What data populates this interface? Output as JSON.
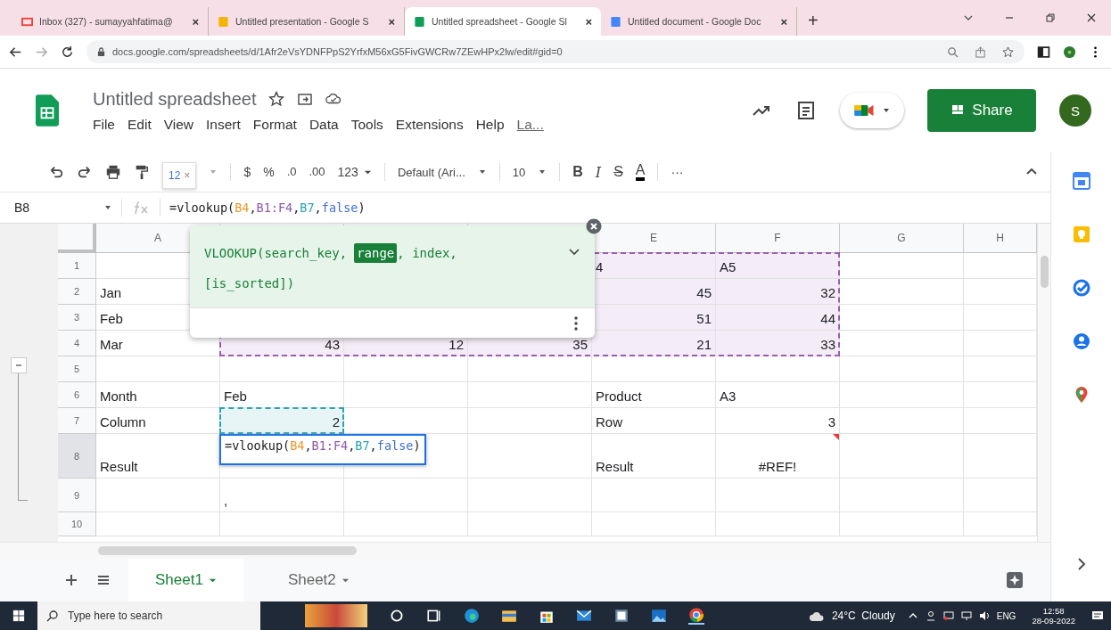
{
  "browser": {
    "tabs": [
      {
        "kind": "gmail",
        "title": "Inbox (327) - sumayyahfatima@",
        "close": "×",
        "selected": false
      },
      {
        "kind": "slides",
        "title": "Untitled presentation - Google S",
        "close": "×",
        "selected": false
      },
      {
        "kind": "sheets",
        "title": "Untitled spreadsheet - Google Sl",
        "close": "×",
        "selected": true
      },
      {
        "kind": "docs",
        "title": "Untitled document - Google Doc",
        "close": "×",
        "selected": false
      }
    ],
    "new_tab": "+",
    "url": "docs.google.com/spreadsheets/d/1Afr2eVsYDNFPpS2YrfxM56xG5FivGWCRw7ZEwHPx2lw/edit#gid=0"
  },
  "app": {
    "title": "Untitled spreadsheet",
    "menu": [
      "File",
      "Edit",
      "View",
      "Insert",
      "Format",
      "Data",
      "Tools",
      "Extensions",
      "Help"
    ],
    "last_edit": "La...",
    "share": "Share",
    "avatar": "S"
  },
  "toolbar": {
    "zoom": "12",
    "zoom_close": "×",
    "currency": "$",
    "percent": "%",
    "decrease_decimals": ".0",
    "increase_decimals": ".00",
    "more_formats": "123",
    "font": "Default (Ari...",
    "font_size": "10",
    "bold": "B",
    "italic": "I",
    "strikethrough": "S",
    "text_color": "A",
    "more": "···"
  },
  "formula_bar": {
    "name_box": "B8",
    "tokens": [
      {
        "text": "=vlookup("
      },
      {
        "text": "B4",
        "color": "#e69b2e"
      },
      {
        "text": ","
      },
      {
        "text": "B1:F4",
        "color": "#8e5ba8"
      },
      {
        "text": ","
      },
      {
        "text": "B7",
        "color": "#2aa4b0"
      },
      {
        "text": ","
      },
      {
        "text": "false",
        "color": "#3d6fd1"
      },
      {
        "text": ")"
      }
    ]
  },
  "grid": {
    "columns": [
      {
        "label": "A",
        "selected": false
      },
      {},
      {},
      {},
      {
        "label": "E",
        "selected": false
      },
      {
        "label": "F",
        "selected": false
      },
      {
        "label": "G",
        "selected": false
      },
      {
        "label": "H",
        "selected": false
      }
    ],
    "rows": [
      {
        "label": "1",
        "selected": false,
        "cells": [
          {},
          {},
          {},
          {},
          {
            "text": "4",
            "highlighted": true
          },
          {
            "text": "A5",
            "highlighted": true
          },
          {},
          {}
        ]
      },
      {
        "label": "2",
        "selected": false,
        "cells": [
          {
            "text": "Jan"
          },
          {},
          {},
          {},
          {
            "text": "45",
            "kind": "number",
            "highlighted": true
          },
          {
            "text": "32",
            "kind": "number",
            "highlighted": true
          },
          {},
          {}
        ]
      },
      {
        "label": "3",
        "selected": false,
        "cells": [
          {
            "text": "Feb"
          },
          {},
          {},
          {},
          {
            "text": "51",
            "kind": "number",
            "highlighted": true
          },
          {
            "text": "44",
            "kind": "number",
            "highlighted": true
          },
          {},
          {}
        ]
      },
      {
        "label": "4",
        "selected": false,
        "cells": [
          {
            "text": "Mar"
          },
          {
            "text": "43",
            "kind": "number",
            "highlighted": true
          },
          {
            "text": "12",
            "kind": "number",
            "highlighted": true
          },
          {
            "text": "35",
            "kind": "number",
            "highlighted": true
          },
          {
            "text": "21",
            "kind": "number",
            "highlighted": true
          },
          {
            "text": "33",
            "kind": "number",
            "highlighted": true,
            "color": "#9c5bb5"
          },
          {},
          {}
        ]
      },
      {
        "label": "5",
        "selected": false,
        "cells": [
          {},
          {},
          {},
          {},
          {},
          {},
          {},
          {}
        ]
      },
      {
        "label": "6",
        "selected": false,
        "cells": [
          {
            "text": "Month"
          },
          {
            "text": "Feb"
          },
          {},
          {},
          {
            "text": "Product"
          },
          {
            "text": "A3"
          },
          {},
          {}
        ]
      },
      {
        "label": "7",
        "selected": false,
        "cells": [
          {
            "text": "Column"
          },
          {
            "text": "2",
            "kind": "number",
            "highlighted": true,
            "color": "#2aa4b0"
          },
          {},
          {},
          {
            "text": "Row"
          },
          {
            "text": "3",
            "kind": "number"
          },
          {},
          {}
        ]
      },
      {
        "label": "8",
        "selected": true,
        "cells": [
          {
            "text": "Result"
          },
          {
            "editor": [
              {
                "text": "=vlookup("
              },
              {
                "text": "B4",
                "color": "#e69b2e"
              },
              {
                "text": ","
              },
              {
                "text": "B1:F4",
                "color": "#8e5ba8"
              },
              {
                "text": ","
              },
              {
                "text": "B7",
                "color": "#2aa4b0"
              },
              {
                "text": ","
              },
              {
                "text": "false",
                "color": "#3d6fd1"
              },
              {
                "text": ")"
              }
            ]
          },
          {},
          {},
          {
            "text": "Result"
          },
          {
            "text": "#REF!",
            "kind": "error"
          },
          {},
          {}
        ]
      },
      {
        "label": "9",
        "selected": false,
        "cells": [
          {},
          {
            "text": ","
          },
          {},
          {},
          {},
          {},
          {},
          {}
        ]
      },
      {
        "label": "10",
        "selected": false,
        "cells": [
          {},
          {},
          {},
          {},
          {},
          {},
          {},
          {}
        ]
      }
    ]
  },
  "formula_help": {
    "signature": [
      {
        "text": "VLOOKUP(search_key,",
        "selected": false
      },
      {
        "text": "range",
        "selected": true
      },
      {
        "text": ", index,",
        "selected": false
      },
      {
        "text": "[is_sorted])",
        "selected": false
      }
    ]
  },
  "sheets": [
    {
      "name": "Sheet1",
      "selected": true
    },
    {
      "name": "Sheet2",
      "selected": false
    }
  ],
  "taskbar": {
    "search_placeholder": "Type here to search",
    "weather": "24°C  Cloudy",
    "language": "ENG",
    "time": "12:58",
    "date": "28-09-2022"
  }
}
